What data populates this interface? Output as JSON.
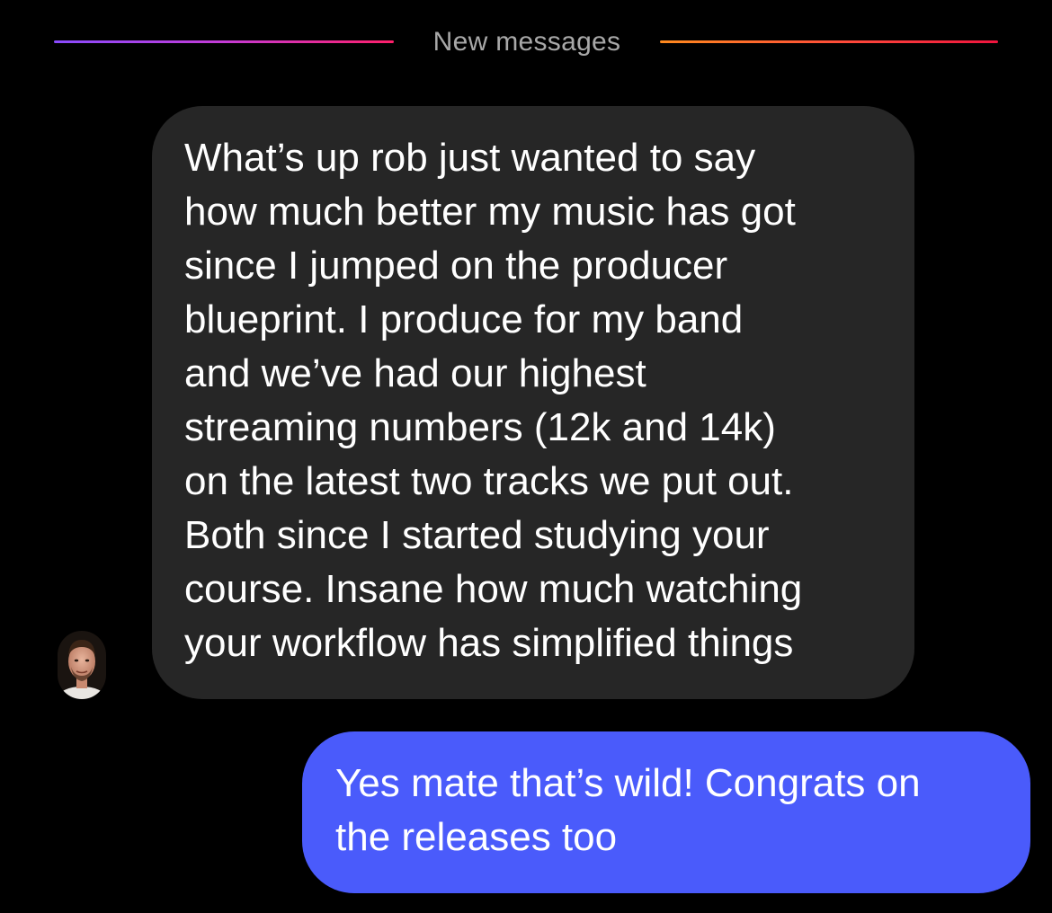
{
  "divider": {
    "label": "New messages"
  },
  "colors": {
    "background": "#000000",
    "incoming_bubble": "#262626",
    "outgoing_bubble": "#4a5bfb",
    "divider_label": "#a8a8a8"
  },
  "messages": [
    {
      "sender": "contact",
      "lines": [
        "What’s up rob just wanted to say",
        "how much better my music has got",
        "since I jumped on the producer",
        "blueprint. I produce for my band",
        "and we’ve had our highest",
        "streaming numbers (12k and 14k)",
        "on the latest two tracks we put out.",
        "Both since I started studying your",
        "course. Insane how much watching",
        "your workflow has simplified things"
      ]
    },
    {
      "sender": "me",
      "lines": [
        "Yes mate that’s wild! Congrats on",
        "the releases too"
      ]
    }
  ],
  "avatar": {
    "icon": "profile-photo"
  }
}
